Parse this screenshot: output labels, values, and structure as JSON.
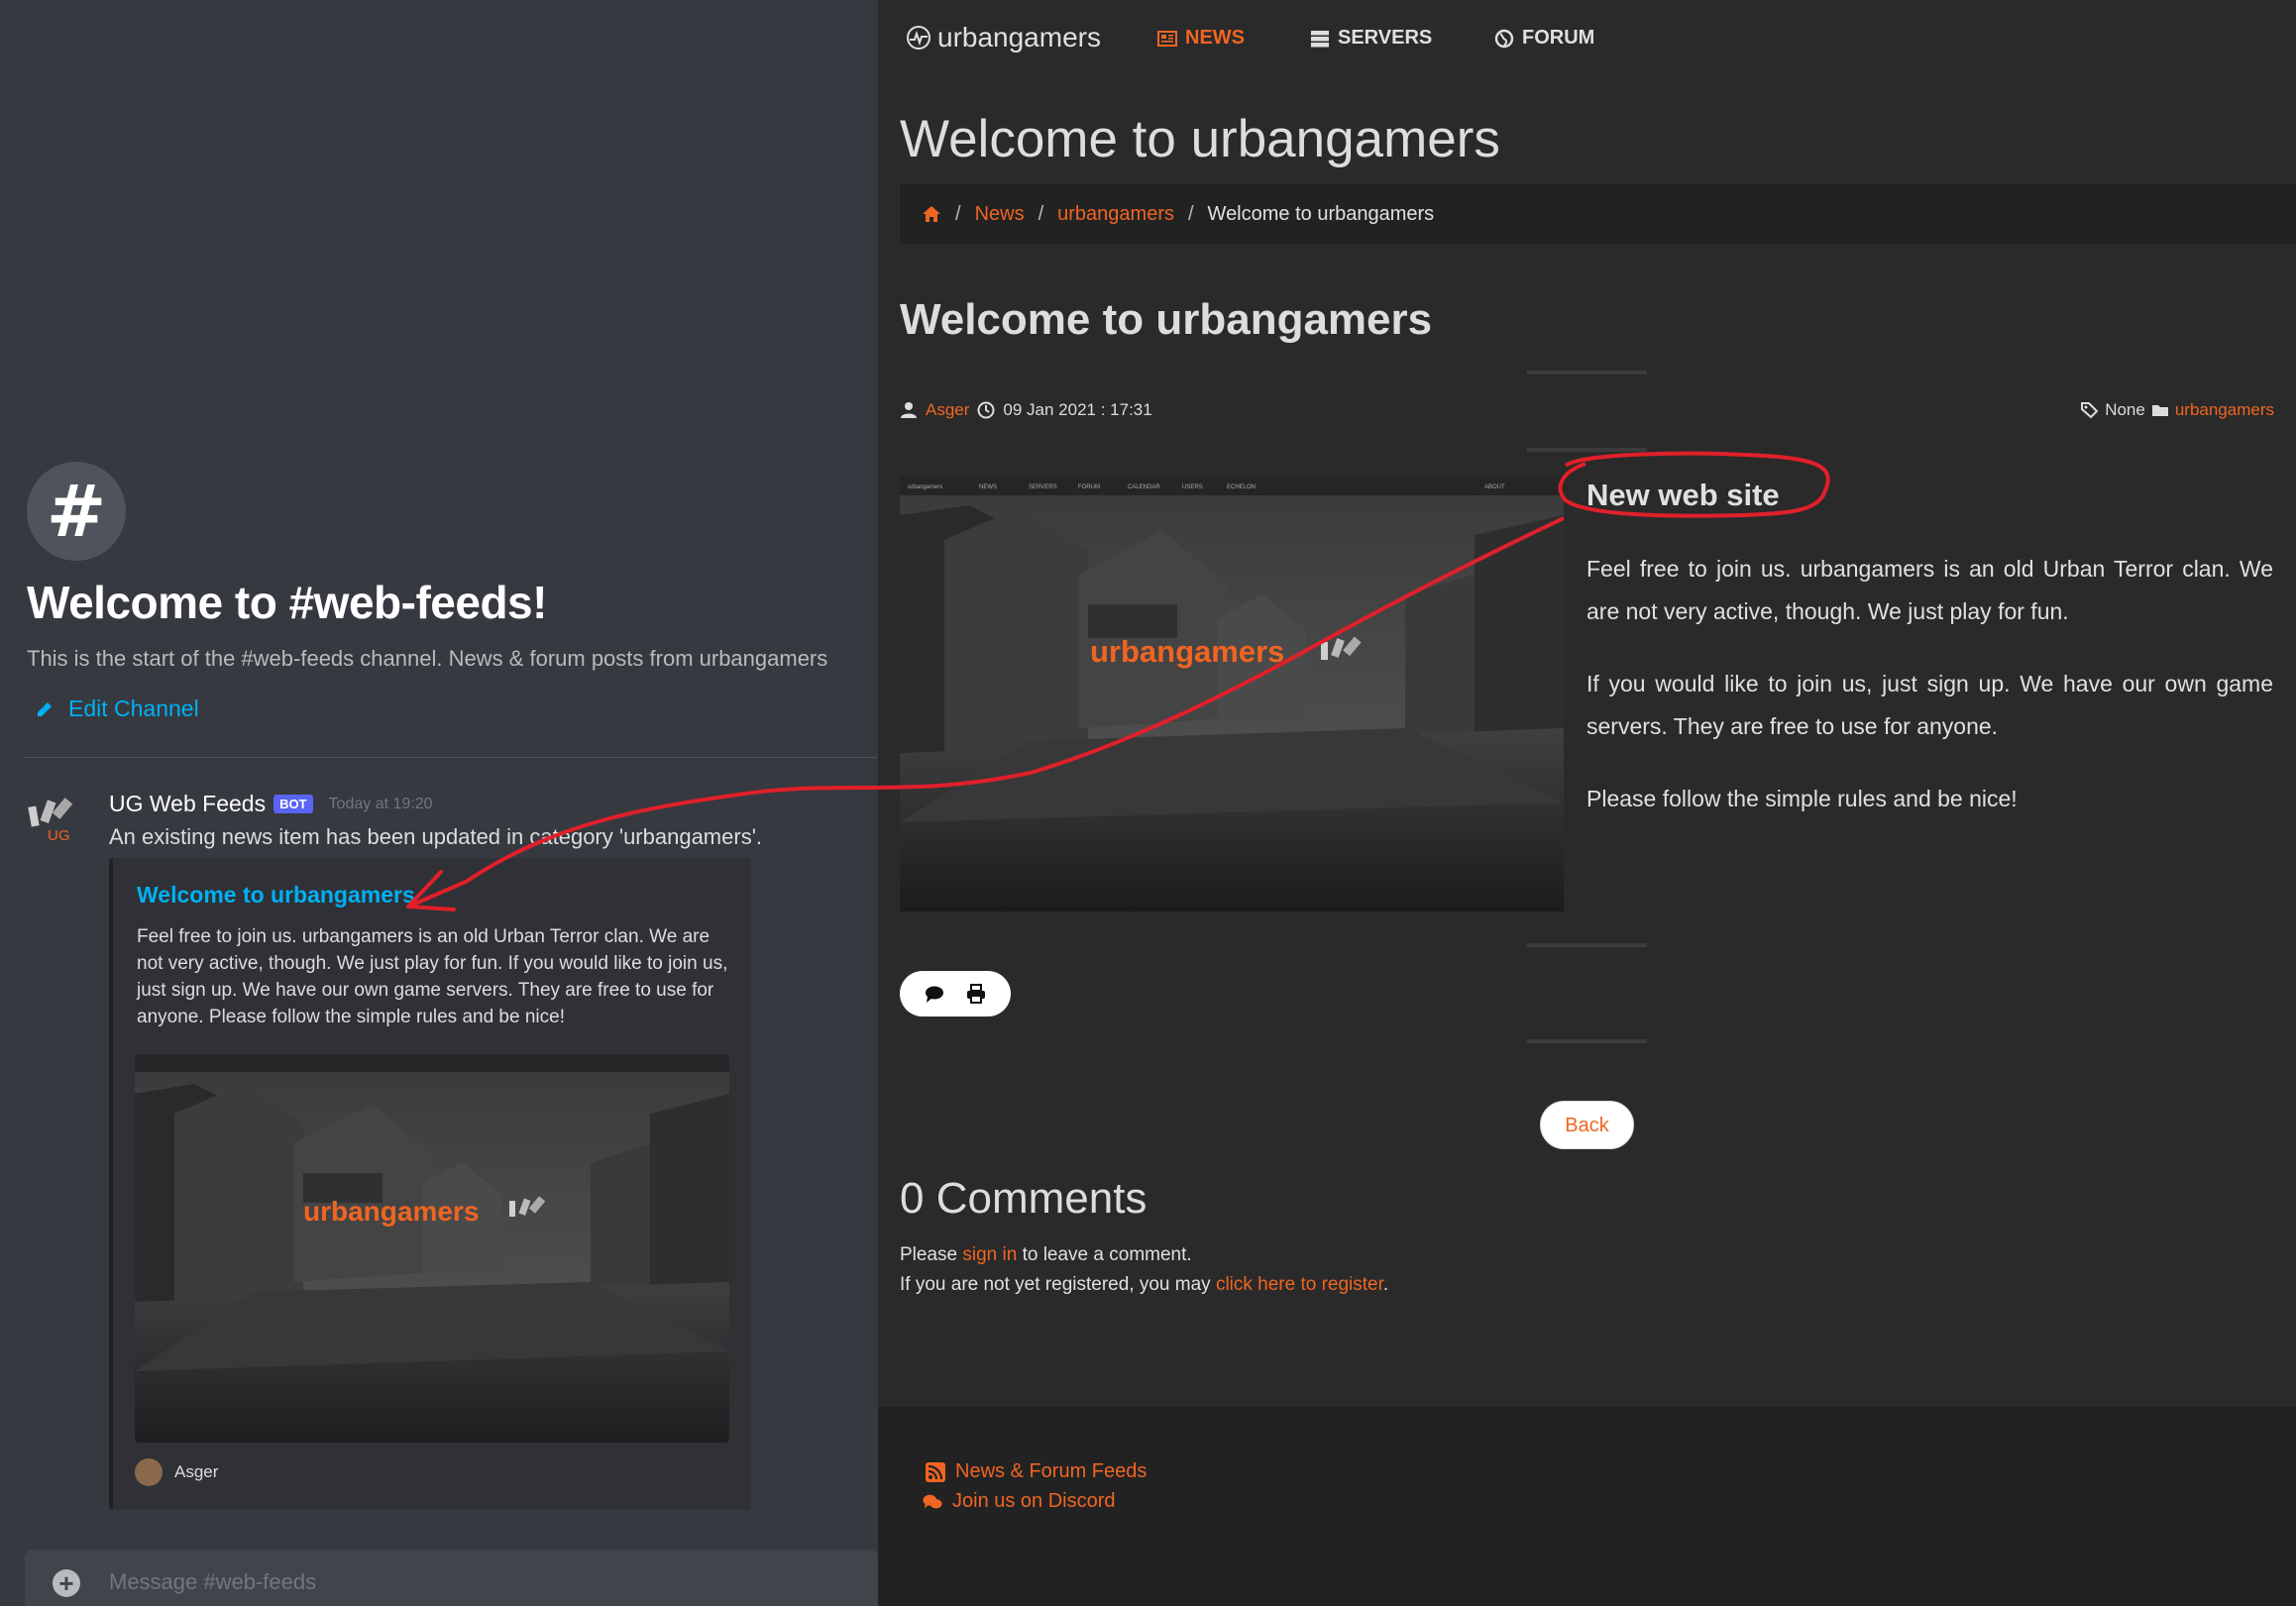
{
  "discord": {
    "channel_title": "Welcome to #web-feeds!",
    "channel_desc": "This is the start of the #web-feeds channel. News & forum posts from urbangamers",
    "edit_channel": "Edit Channel",
    "message": {
      "author": "UG Web Feeds",
      "bot_tag": "BOT",
      "time": "Today at 19:20",
      "avatar_label": "UG",
      "text": "An existing news item has been updated in category 'urbangamers'."
    },
    "embed": {
      "title": "Welcome to urbangamers",
      "description": "Feel free to join us. urbangamers is an old Urban Terror clan. We are not very active, though. We just play for fun. If you would like to join us, just sign up. We have our own game servers. They are free to use for anyone. Please follow the simple rules and be nice!",
      "footer_author": "Asger"
    },
    "input_placeholder": "Message #web-feeds"
  },
  "web": {
    "brand": "urbangamers",
    "nav": {
      "news": "NEWS",
      "servers": "SERVERS",
      "forum": "FORUM"
    },
    "page_title": "Welcome to urbangamers",
    "breadcrumb": {
      "news": "News",
      "category": "urbangamers",
      "current": "Welcome to urbangamers"
    },
    "article": {
      "title": "Welcome to urbangamers",
      "author": "Asger",
      "date": "09 Jan 2021 : 17:31",
      "tags": "None",
      "category": "urbangamers",
      "heading": "New web site",
      "paragraphs": [
        "Feel free to join us. urbangamers is an old Urban Terror clan. We are not very active, though. We just play for fun.",
        "If you would like to join us, just sign up. We have our own game servers. They are free to use for anyone.",
        "Please follow the simple rules and be nice!"
      ],
      "image_logo_text": "urbangamers",
      "image_nav": [
        "NEWS",
        "SERVERS",
        "FORUM",
        "CALENDAR",
        "USERS",
        "ECHELON",
        "ABOUT"
      ]
    },
    "back_label": "Back",
    "comments": {
      "title": "0 Comments",
      "line1_pre": "Please ",
      "line1_link": "sign in",
      "line1_post": " to leave a comment.",
      "line2_pre": "If you are not yet registered, you may ",
      "line2_link": "click here to register",
      "line2_post": "."
    },
    "footer": {
      "feeds": "News & Forum Feeds",
      "discord": "Join us on Discord"
    }
  },
  "colors": {
    "accent": "#f06522",
    "discord_link": "#00b0f4",
    "annotation": "#e0202a"
  }
}
